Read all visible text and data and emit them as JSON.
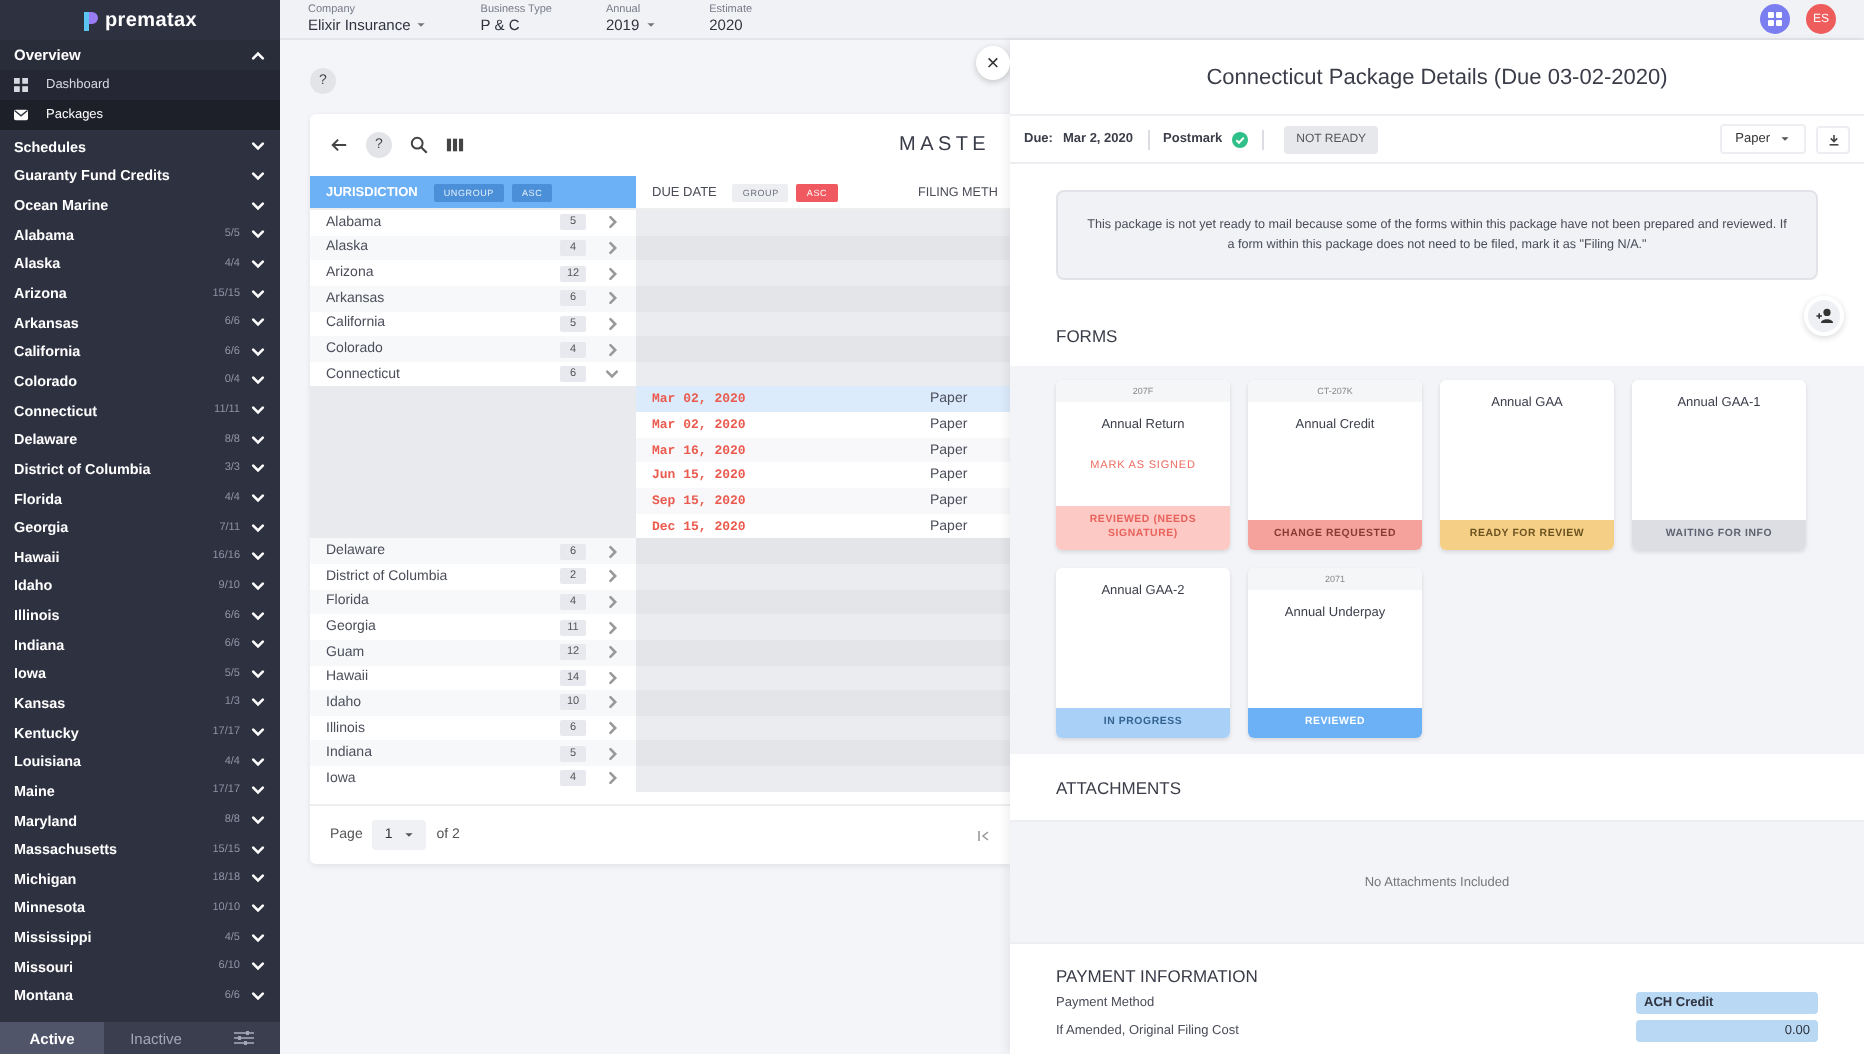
{
  "sidebar": {
    "logo": "prematax",
    "sections": [
      {
        "label": "Overview",
        "expanded": true,
        "children": [
          {
            "label": "Dashboard",
            "kind": "dashboard",
            "selected": false
          },
          {
            "label": "Packages",
            "kind": "mail",
            "selected": true
          }
        ]
      }
    ],
    "items": [
      {
        "label": "Schedules",
        "expanded": false
      },
      {
        "label": "Guaranty Fund Credits",
        "expanded": false
      },
      {
        "label": "Ocean Marine",
        "expanded": false
      },
      {
        "label": "Alabama",
        "count": "5/5",
        "expanded": false
      },
      {
        "label": "Alaska",
        "count": "4/4",
        "expanded": false
      },
      {
        "label": "Arizona",
        "count": "15/15",
        "expanded": false
      },
      {
        "label": "Arkansas",
        "count": "6/6",
        "expanded": false
      },
      {
        "label": "California",
        "count": "6/6",
        "expanded": false
      },
      {
        "label": "Colorado",
        "count": "0/4",
        "expanded": false
      },
      {
        "label": "Connecticut",
        "count": "11/11",
        "expanded": false
      },
      {
        "label": "Delaware",
        "count": "8/8",
        "expanded": false
      },
      {
        "label": "District of Columbia",
        "count": "3/3",
        "expanded": false
      },
      {
        "label": "Florida",
        "count": "4/4",
        "expanded": false
      },
      {
        "label": "Georgia",
        "count": "7/11",
        "expanded": false
      },
      {
        "label": "Hawaii",
        "count": "16/16",
        "expanded": false
      },
      {
        "label": "Idaho",
        "count": "9/10",
        "expanded": false
      },
      {
        "label": "Illinois",
        "count": "6/6",
        "expanded": false
      },
      {
        "label": "Indiana",
        "count": "6/6",
        "expanded": false
      },
      {
        "label": "Iowa",
        "count": "5/5",
        "expanded": false
      },
      {
        "label": "Kansas",
        "count": "1/3",
        "expanded": false
      },
      {
        "label": "Kentucky",
        "count": "17/17",
        "expanded": false
      },
      {
        "label": "Louisiana",
        "count": "4/4",
        "expanded": false
      },
      {
        "label": "Maine",
        "count": "17/17",
        "expanded": false
      },
      {
        "label": "Maryland",
        "count": "8/8",
        "expanded": false
      },
      {
        "label": "Massachusetts",
        "count": "15/15",
        "expanded": false
      },
      {
        "label": "Michigan",
        "count": "18/18",
        "expanded": false
      },
      {
        "label": "Minnesota",
        "count": "10/10",
        "expanded": false
      },
      {
        "label": "Mississippi",
        "count": "4/5",
        "expanded": false
      },
      {
        "label": "Missouri",
        "count": "6/10",
        "expanded": false
      },
      {
        "label": "Montana",
        "count": "6/6",
        "expanded": false
      }
    ],
    "tabs": [
      {
        "label": "Active",
        "selected": true
      },
      {
        "label": "Inactive",
        "selected": false
      }
    ]
  },
  "header": {
    "filters": [
      {
        "label": "Company",
        "value": "Elixir Insurance",
        "dropdown": true
      },
      {
        "label": "Business Type",
        "value": "P & C",
        "dropdown": false
      },
      {
        "label": "Annual",
        "value": "2019",
        "dropdown": true
      },
      {
        "label": "Estimate",
        "value": "2020",
        "dropdown": false
      }
    ],
    "user_initials": "ES"
  },
  "main": {
    "help": "?",
    "close": "×"
  },
  "table": {
    "help": "?",
    "title": "MASTE",
    "columns": [
      {
        "label": "JURISDICTION",
        "grouped": true,
        "chips": [
          {
            "label": "UNGROUP",
            "kind": "header"
          },
          {
            "label": "ASC",
            "kind": "header"
          }
        ]
      },
      {
        "label": "DUE DATE",
        "grouped": false,
        "chips": [
          {
            "label": "GROUP",
            "kind": "plain"
          },
          {
            "label": "ASC",
            "kind": "sort"
          }
        ]
      },
      {
        "label": "FILING METH",
        "grouped": false
      }
    ],
    "rows": [
      {
        "kind": "group",
        "name": "Alabama",
        "count": "5",
        "expanded": false
      },
      {
        "kind": "group",
        "name": "Alaska",
        "count": "4",
        "expanded": false
      },
      {
        "kind": "group",
        "name": "Arizona",
        "count": "12",
        "expanded": false
      },
      {
        "kind": "group",
        "name": "Arkansas",
        "count": "6",
        "expanded": false
      },
      {
        "kind": "group",
        "name": "California",
        "count": "5",
        "expanded": false
      },
      {
        "kind": "group",
        "name": "Colorado",
        "count": "4",
        "expanded": false
      },
      {
        "kind": "group",
        "name": "Connecticut",
        "count": "6",
        "expanded": true
      },
      {
        "kind": "item",
        "due_date": "Mar 02, 2020",
        "filing_method": "Paper",
        "selected": true
      },
      {
        "kind": "item",
        "due_date": "Mar 02, 2020",
        "filing_method": "Paper",
        "selected": false
      },
      {
        "kind": "item",
        "due_date": "Mar 16, 2020",
        "filing_method": "Paper",
        "selected": false
      },
      {
        "kind": "item",
        "due_date": "Jun 15, 2020",
        "filing_method": "Paper",
        "selected": false
      },
      {
        "kind": "item",
        "due_date": "Sep 15, 2020",
        "filing_method": "Paper",
        "selected": false
      },
      {
        "kind": "item",
        "due_date": "Dec 15, 2020",
        "filing_method": "Paper",
        "selected": false
      },
      {
        "kind": "group",
        "name": "Delaware",
        "count": "6",
        "expanded": false
      },
      {
        "kind": "group",
        "name": "District of Columbia",
        "count": "2",
        "expanded": false
      },
      {
        "kind": "group",
        "name": "Florida",
        "count": "4",
        "expanded": false
      },
      {
        "kind": "group",
        "name": "Georgia",
        "count": "11",
        "expanded": false
      },
      {
        "kind": "group",
        "name": "Guam",
        "count": "12",
        "expanded": false
      },
      {
        "kind": "group",
        "name": "Hawaii",
        "count": "14",
        "expanded": false
      },
      {
        "kind": "group",
        "name": "Idaho",
        "count": "10",
        "expanded": false
      },
      {
        "kind": "group",
        "name": "Illinois",
        "count": "6",
        "expanded": false
      },
      {
        "kind": "group",
        "name": "Indiana",
        "count": "5",
        "expanded": false
      },
      {
        "kind": "group",
        "name": "Iowa",
        "count": "4",
        "expanded": false
      }
    ],
    "footer": {
      "page_label": "Page",
      "page": "1",
      "of_label": "of 2"
    }
  },
  "panel": {
    "title": "Connecticut Package Details (Due 03-02-2020)",
    "due_label": "Due:",
    "due_date": "Mar 2, 2020",
    "postmark": "Postmark",
    "postmarked": true,
    "status": "NOT READY",
    "method": "Paper",
    "notice": "This package is not yet ready to mail because some of the forms within this package have not been prepared and reviewed. If a form within this package does not need to be filed, mark it as \"Filing N/A.\"",
    "forms_heading": "FORMS",
    "forms": [
      {
        "code": "207F",
        "title": "Annual Return",
        "action": "MARK AS SIGNED",
        "status": "REVIEWED (NEEDS SIGNATURE)",
        "kind": "needs-signature"
      },
      {
        "code": "CT-207K",
        "title": "Annual Credit",
        "status": "CHANGE REQUESTED",
        "kind": "change-requested"
      },
      {
        "title": "Annual GAA",
        "status": "READY FOR REVIEW",
        "kind": "ready"
      },
      {
        "title": "Annual GAA-1",
        "status": "WAITING FOR INFO",
        "kind": "waiting"
      },
      {
        "title": "Annual GAA-2",
        "status": "IN PROGRESS",
        "kind": "in-progress"
      },
      {
        "code": "2071",
        "title": "Annual Underpay",
        "status": "REVIEWED",
        "kind": "reviewed"
      }
    ],
    "attachments_heading": "ATTACHMENTS",
    "attachments_empty": "No Attachments Included",
    "payment_heading": "PAYMENT INFORMATION",
    "payment_rows": [
      {
        "label": "Payment Method",
        "value": "ACH Credit",
        "kind": "text"
      },
      {
        "label": "If Amended, Original Filing Cost",
        "value": "0.00",
        "kind": "amount"
      }
    ]
  }
}
